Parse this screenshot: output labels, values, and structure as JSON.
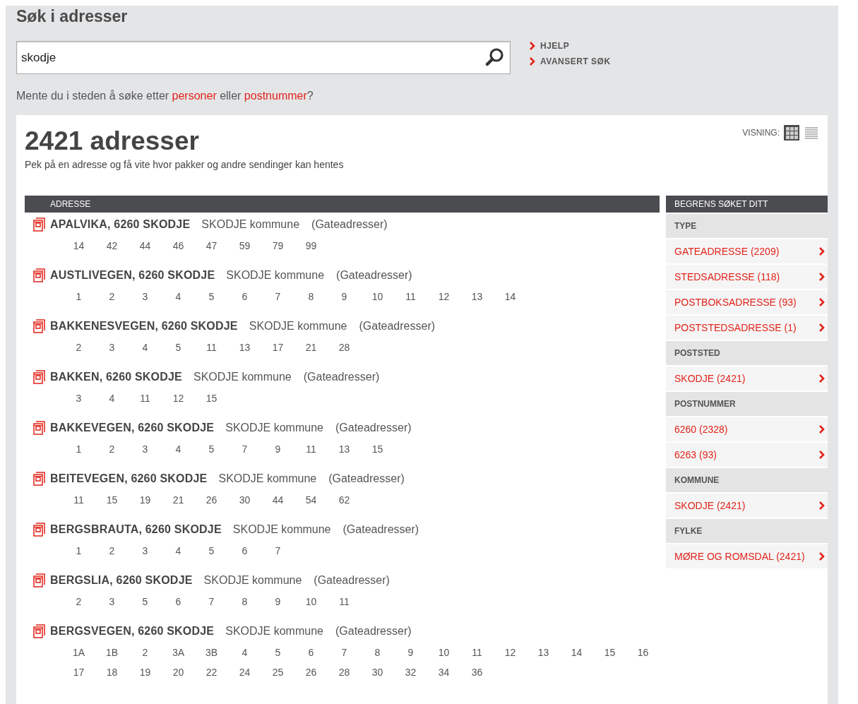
{
  "page_title": "Søk i adresser",
  "search": {
    "value": "skodje"
  },
  "side_links": [
    "HJELP",
    "AVANSERT SØK"
  ],
  "suggestion_parts": [
    {
      "kind": "text",
      "text": "Mente du i steden å søke etter "
    },
    {
      "kind": "link",
      "text": "personer"
    },
    {
      "kind": "text",
      "text": " eller "
    },
    {
      "kind": "link",
      "text": "postnummer"
    },
    {
      "kind": "text",
      "text": "?"
    }
  ],
  "results": {
    "count_title": "2421 adresser",
    "subtitle": "Pek på en adresse og få vite hvor pakker og andre sendinger kan hentes",
    "view_label": "VISNING:",
    "views": [
      {
        "kind": "grid",
        "selected": true
      },
      {
        "kind": "list",
        "selected": false
      }
    ],
    "column": "ADRESSE",
    "addresses": [
      {
        "name": "APALVIKA, 6260 SKODJE",
        "municipality": "SKODJE kommune",
        "type": "(Gateadresser)",
        "numbers": [
          "14",
          "42",
          "44",
          "46",
          "47",
          "59",
          "79",
          "99"
        ]
      },
      {
        "name": "AUSTLIVEGEN, 6260 SKODJE",
        "municipality": "SKODJE kommune",
        "type": "(Gateadresser)",
        "numbers": [
          "1",
          "2",
          "3",
          "4",
          "5",
          "6",
          "7",
          "8",
          "9",
          "10",
          "11",
          "12",
          "13",
          "14"
        ]
      },
      {
        "name": "BAKKENESVEGEN, 6260 SKODJE",
        "municipality": "SKODJE kommune",
        "type": "(Gateadresser)",
        "numbers": [
          "2",
          "3",
          "4",
          "5",
          "11",
          "13",
          "17",
          "21",
          "28"
        ]
      },
      {
        "name": "BAKKEN, 6260 SKODJE",
        "municipality": "SKODJE kommune",
        "type": "(Gateadresser)",
        "numbers": [
          "3",
          "4",
          "11",
          "12",
          "15"
        ]
      },
      {
        "name": "BAKKEVEGEN, 6260 SKODJE",
        "municipality": "SKODJE kommune",
        "type": "(Gateadresser)",
        "numbers": [
          "1",
          "2",
          "3",
          "4",
          "5",
          "7",
          "9",
          "11",
          "13",
          "15"
        ]
      },
      {
        "name": "BEITEVEGEN, 6260 SKODJE",
        "municipality": "SKODJE kommune",
        "type": "(Gateadresser)",
        "numbers": [
          "11",
          "15",
          "19",
          "21",
          "26",
          "30",
          "44",
          "54",
          "62"
        ]
      },
      {
        "name": "BERGSBRAUTA, 6260 SKODJE",
        "municipality": "SKODJE kommune",
        "type": "(Gateadresser)",
        "numbers": [
          "1",
          "2",
          "3",
          "4",
          "5",
          "6",
          "7"
        ]
      },
      {
        "name": "BERGSLIA, 6260 SKODJE",
        "municipality": "SKODJE kommune",
        "type": "(Gateadresser)",
        "numbers": [
          "2",
          "3",
          "5",
          "6",
          "7",
          "8",
          "9",
          "10",
          "11"
        ]
      },
      {
        "name": "BERGSVEGEN, 6260 SKODJE",
        "municipality": "SKODJE kommune",
        "type": "(Gateadresser)",
        "numbers": [
          "1A",
          "1B",
          "2",
          "3A",
          "3B",
          "4",
          "5",
          "6",
          "7",
          "8",
          "9",
          "10",
          "11",
          "12",
          "13",
          "14",
          "15",
          "16",
          "17",
          "18",
          "19",
          "20",
          "22",
          "24",
          "25",
          "26",
          "28",
          "30",
          "32",
          "34",
          "36"
        ]
      }
    ]
  },
  "filters": {
    "title": "BEGRENS SØKET DITT",
    "groups": [
      {
        "heading": "TYPE",
        "items": [
          "GATEADRESSE (2209)",
          "STEDSADRESSE (118)",
          "POSTBOKSADRESSE (93)",
          "POSTSTEDSADRESSE (1)"
        ]
      },
      {
        "heading": "POSTSTED",
        "items": [
          "SKODJE (2421)"
        ]
      },
      {
        "heading": "POSTNUMMER",
        "items": [
          "6260 (2328)",
          "6263 (93)"
        ]
      },
      {
        "heading": "KOMMUNE",
        "items": [
          "SKODJE (2421)"
        ]
      },
      {
        "heading": "FYLKE",
        "items": [
          "MØRE OG ROMSDAL (2421)"
        ]
      }
    ]
  }
}
